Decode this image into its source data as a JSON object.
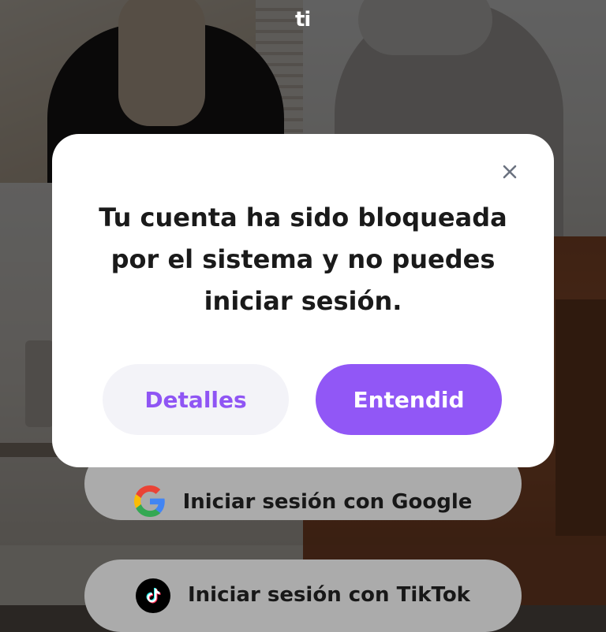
{
  "app": {
    "logo_text": "ti"
  },
  "dialog": {
    "message": "Tu cuenta ha sido bloqueada por el sistema y no puedes iniciar sesión.",
    "details_label": "Detalles",
    "ok_label": "Entendid",
    "close_icon": "close-icon"
  },
  "login": {
    "google_label": "Iniciar sesión con Google",
    "tiktok_label": "Iniciar sesión con TikTok",
    "google_icon": "google-logo-icon",
    "tiktok_icon": "tiktok-logo-icon"
  },
  "colors": {
    "accent": "#9157f6",
    "accent_text": "#8f55f4",
    "secondary_button": "#f3f3f8",
    "modal_bg": "#ffffff",
    "login_button_bg": "#ababab"
  }
}
